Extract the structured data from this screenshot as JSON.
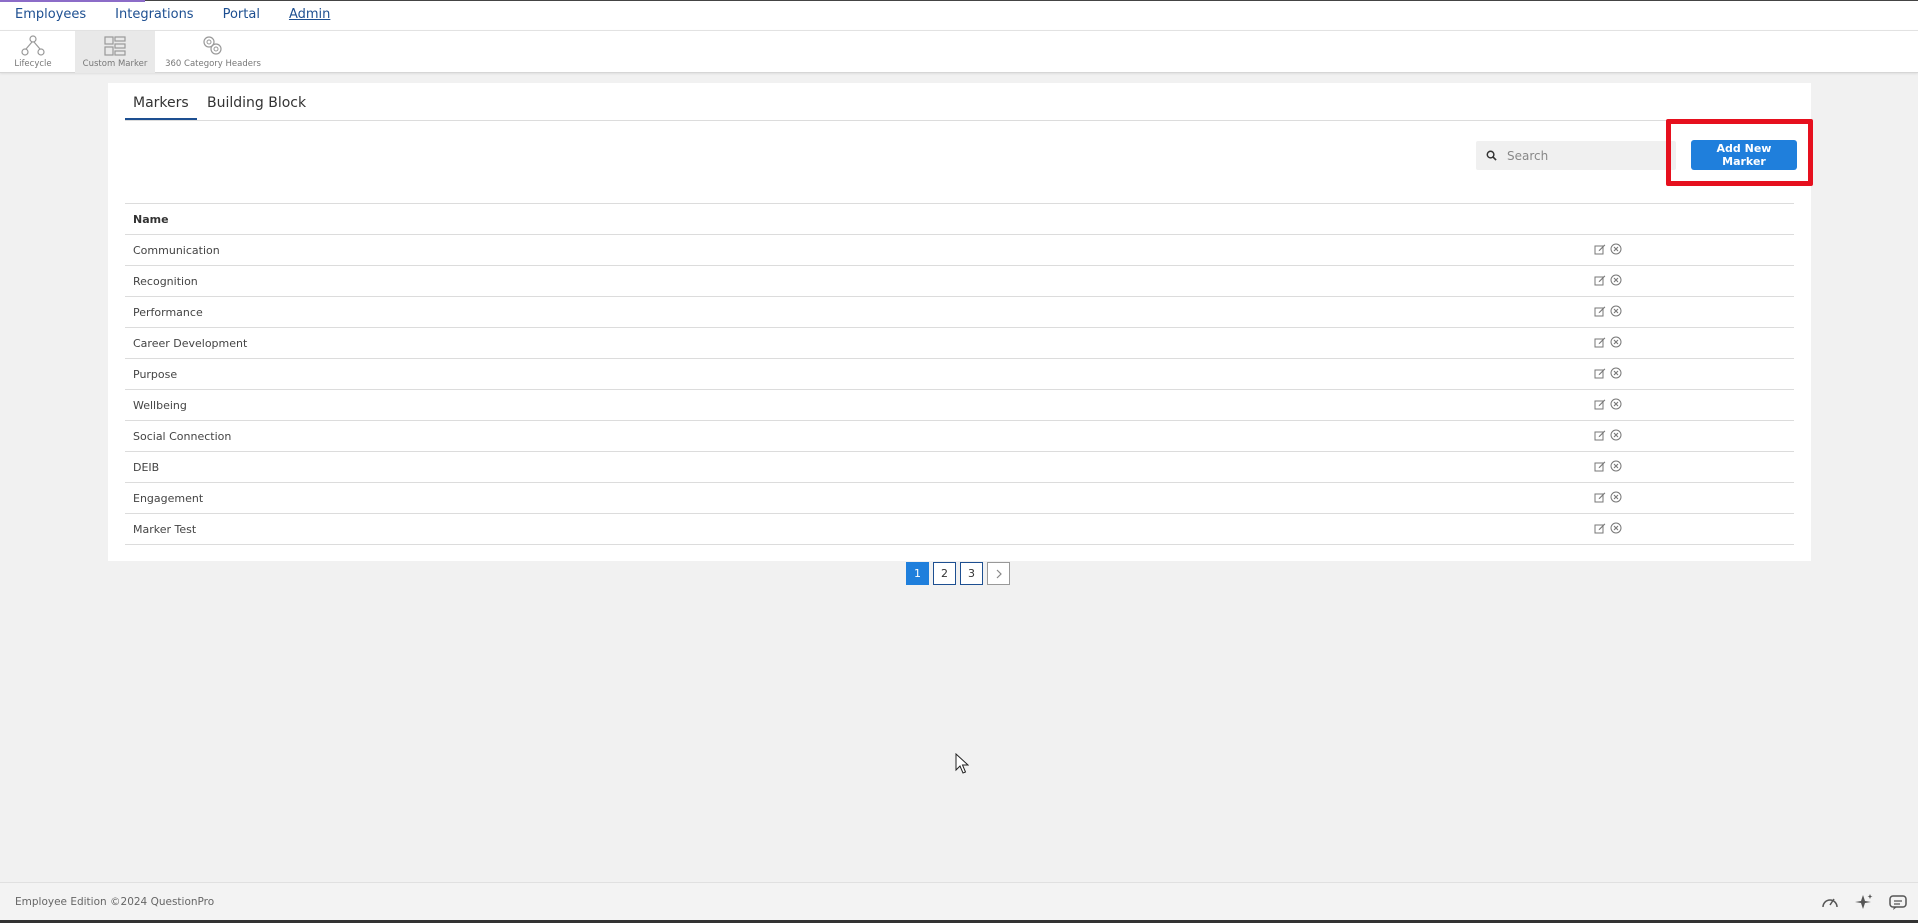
{
  "topnav": {
    "items": [
      {
        "label": "Employees"
      },
      {
        "label": "Integrations"
      },
      {
        "label": "Portal"
      },
      {
        "label": "Admin",
        "active": true
      }
    ]
  },
  "subnav": {
    "items": [
      {
        "label": "Lifecycle",
        "icon": "lifecycle-icon"
      },
      {
        "label": "Custom Marker",
        "icon": "custom-marker-icon",
        "selected": true
      },
      {
        "label": "360 Category Headers",
        "icon": "category-headers-icon"
      }
    ]
  },
  "tabs": [
    {
      "label": "Markers",
      "active": true
    },
    {
      "label": "Building Block"
    }
  ],
  "search": {
    "placeholder": "Search",
    "value": ""
  },
  "toolbar": {
    "add_label": "Add New Marker"
  },
  "table": {
    "columns": [
      "Name"
    ],
    "rows": [
      {
        "name": "Communication"
      },
      {
        "name": "Recognition"
      },
      {
        "name": "Performance"
      },
      {
        "name": "Career Development"
      },
      {
        "name": "Purpose"
      },
      {
        "name": "Wellbeing"
      },
      {
        "name": "Social Connection"
      },
      {
        "name": "DEIB"
      },
      {
        "name": "Engagement"
      },
      {
        "name": "Marker Test"
      }
    ],
    "row_actions": [
      "edit-icon",
      "delete-icon"
    ]
  },
  "pagination": {
    "pages": [
      "1",
      "2",
      "3"
    ],
    "current": "1",
    "next": "›"
  },
  "footer": {
    "copyright": "Employee Edition ©2024 QuestionPro",
    "icons": [
      "speedometer-icon",
      "sparkle-icon",
      "chat-icon"
    ]
  },
  "colors": {
    "primary": "#1f7fdc",
    "nav_link": "#1d4f91",
    "highlight": "#e6101e",
    "background": "#f1f1f1"
  }
}
